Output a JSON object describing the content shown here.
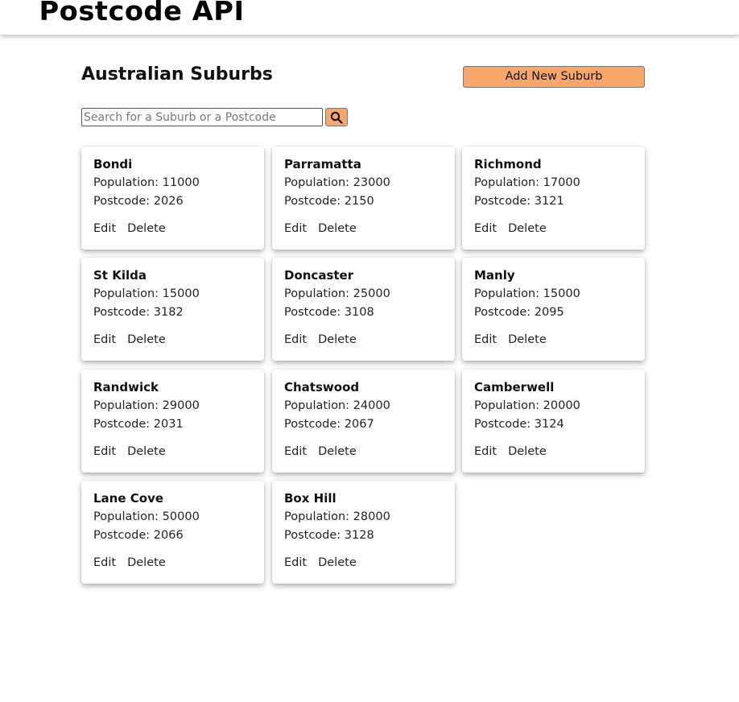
{
  "header": {
    "logo": "Postcode API"
  },
  "main": {
    "title": "Australian Suburbs",
    "add_button_label": "Add New Suburb",
    "search": {
      "placeholder": "Search for a Suburb or a Postcode",
      "value": ""
    },
    "search_icon": "search-icon",
    "accent_color": "#f7a66c"
  },
  "suburbs": [
    {
      "name": "Bondi",
      "population": "Population: 11000",
      "postcode": "Postcode: 2026",
      "edit": "Edit",
      "delete": "Delete"
    },
    {
      "name": "Parramatta",
      "population": "Population: 23000",
      "postcode": "Postcode: 2150",
      "edit": "Edit",
      "delete": "Delete"
    },
    {
      "name": "Richmond",
      "population": "Population: 17000",
      "postcode": "Postcode: 3121",
      "edit": "Edit",
      "delete": "Delete"
    },
    {
      "name": "St Kilda",
      "population": "Population: 15000",
      "postcode": "Postcode: 3182",
      "edit": "Edit",
      "delete": "Delete"
    },
    {
      "name": "Doncaster",
      "population": "Population: 25000",
      "postcode": "Postcode: 3108",
      "edit": "Edit",
      "delete": "Delete"
    },
    {
      "name": "Manly",
      "population": "Population: 15000",
      "postcode": "Postcode: 2095",
      "edit": "Edit",
      "delete": "Delete"
    },
    {
      "name": "Randwick",
      "population": "Population: 29000",
      "postcode": "Postcode: 2031",
      "edit": "Edit",
      "delete": "Delete"
    },
    {
      "name": "Chatswood",
      "population": "Population: 24000",
      "postcode": "Postcode: 2067",
      "edit": "Edit",
      "delete": "Delete"
    },
    {
      "name": "Camberwell",
      "population": "Population: 20000",
      "postcode": "Postcode: 3124",
      "edit": "Edit",
      "delete": "Delete"
    },
    {
      "name": "Lane Cove",
      "population": "Population: 50000",
      "postcode": "Postcode: 2066",
      "edit": "Edit",
      "delete": "Delete"
    },
    {
      "name": "Box Hill",
      "population": "Population: 28000",
      "postcode": "Postcode: 3128",
      "edit": "Edit",
      "delete": "Delete"
    }
  ]
}
